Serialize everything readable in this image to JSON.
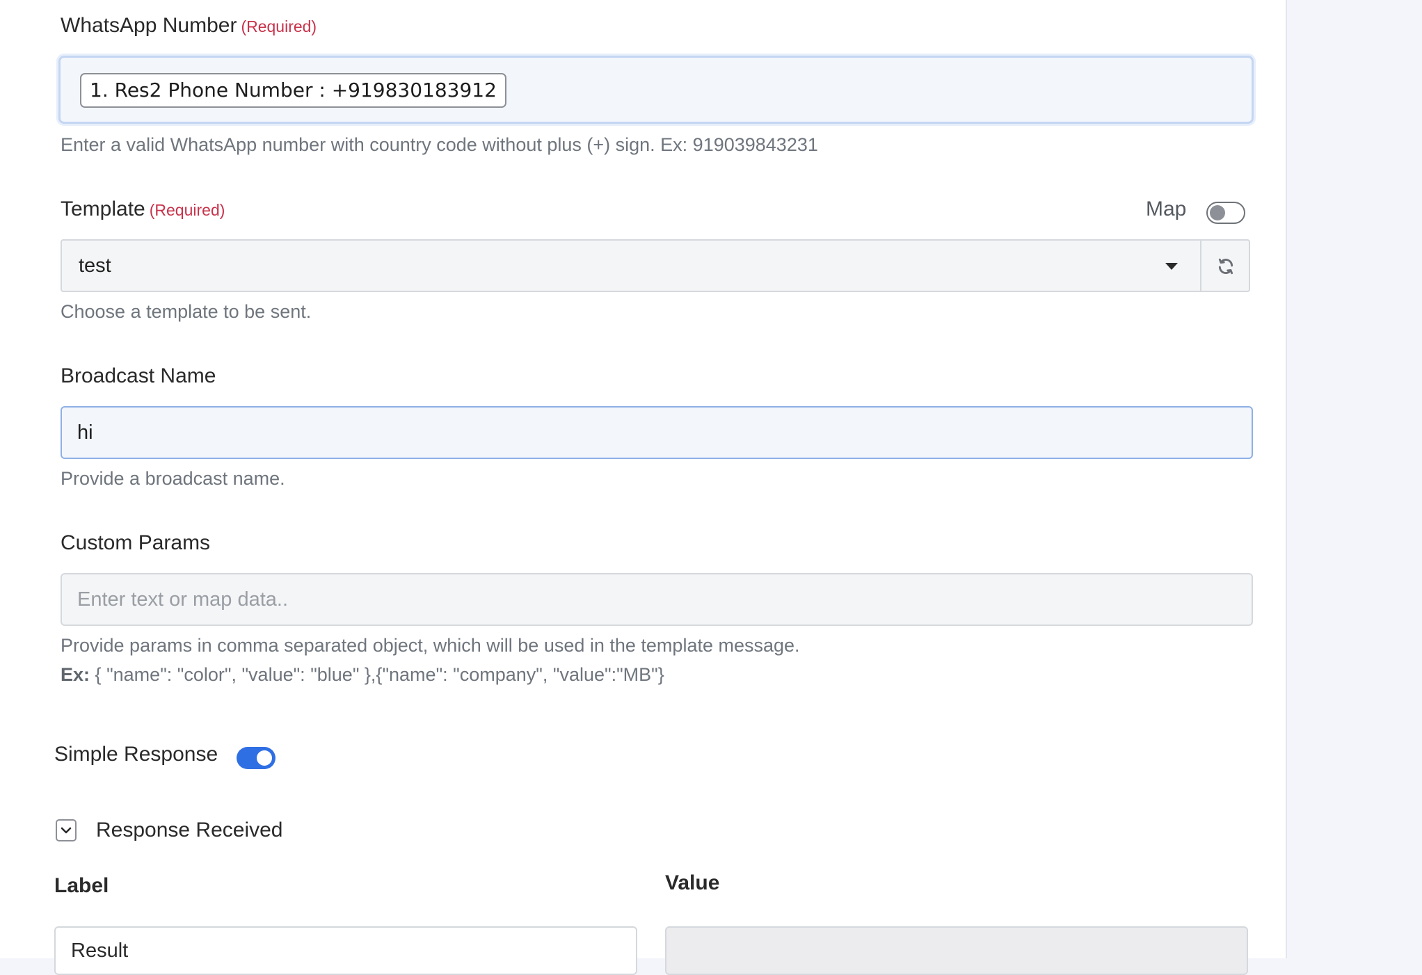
{
  "whatsapp": {
    "label": "WhatsApp Number",
    "required": "(Required)",
    "chip": "1. Res2 Phone Number : +919830183912",
    "help": "Enter a valid WhatsApp number with country code without plus (+) sign. Ex: 919039843231"
  },
  "template": {
    "label": "Template",
    "required": "(Required)",
    "map_label": "Map",
    "map_enabled": false,
    "selected": "test",
    "help": "Choose a template to be sent."
  },
  "broadcast": {
    "label": "Broadcast Name",
    "value": "hi",
    "help": "Provide a broadcast name."
  },
  "custom_params": {
    "label": "Custom Params",
    "placeholder": "Enter text or map data..",
    "help": "Provide params in comma separated object, which will be used in the template message.",
    "example_prefix": "Ex:",
    "example": "{ \"name\": \"color\", \"value\": \"blue\" },{\"name\": \"company\", \"value\":\"MB\"}"
  },
  "simple_response": {
    "label": "Simple Response",
    "enabled": true
  },
  "response_received": {
    "label": "Response Received",
    "label_column": "Label",
    "value_column": "Value",
    "rows": [
      {
        "label": "Result",
        "value": ""
      }
    ]
  },
  "colors": {
    "required": "#c8324a",
    "toggle_on": "#2f6fe4",
    "focus_border": "#8fb0e6"
  }
}
